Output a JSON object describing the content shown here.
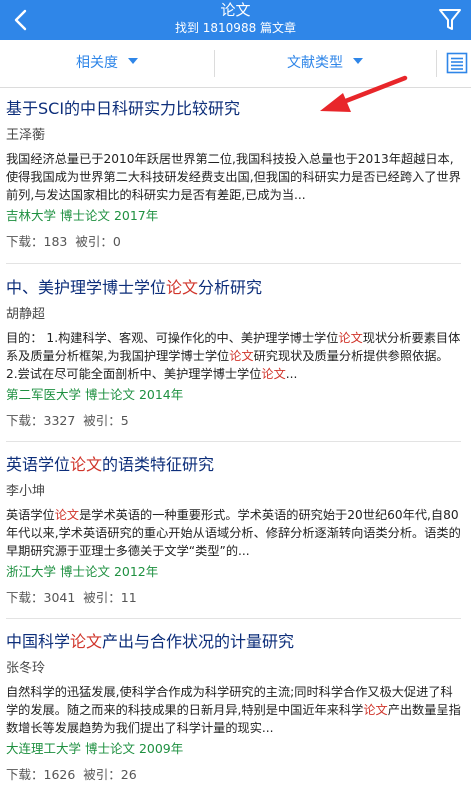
{
  "header": {
    "title": "论文",
    "subtitle": "找到 1810988 篇文章",
    "back_icon": "chevron-left-icon",
    "filter_icon": "filter-funnel-icon"
  },
  "sortbar": {
    "relevance_label": "相关度",
    "type_label": "文献类型",
    "view_icon": "list-view-icon"
  },
  "results": [
    {
      "title": [
        "基于SCI的中日科研实力比较研究"
      ],
      "author": "王泽蘅",
      "abstract": [
        "我国经济总量已于2010年跃居世界第二位,我国科技投入总量也于2013年超越日本,使得我国成为世界第二大科技研发经费支出国,但我国的科研实力是否已经跨入了世界前列,与发达国家相比的科研实力是否有差距,已成为当..."
      ],
      "source": "吉林大学 博士论文 2017年",
      "downloads": "下载：183",
      "citations": "被引：0"
    },
    {
      "title": [
        "中、美护理学博士学位",
        "论文",
        "分析研究"
      ],
      "author": "胡静超",
      "abstract": [
        "目的：  1.构建科学、客观、可操作化的中、美护理学博士学位",
        "论文",
        "现状分析要素目体系及质量分析框架,为我国护理学博士学位",
        "论文",
        "研究现状及质量分析提供参照依据。  2.尝试在尽可能全面剖析中、美护理学博士学位",
        "论文",
        "..."
      ],
      "source": "第二军医大学 博士论文 2014年",
      "downloads": "下载：3327",
      "citations": "被引：5"
    },
    {
      "title": [
        "英语学位",
        "论文",
        "的语类特征研究"
      ],
      "author": "李小坤",
      "abstract": [
        "英语学位",
        "论文",
        "是学术英语的一种重要形式。学术英语的研究始于20世纪60年代,自80年代以来,学术英语研究的重心开始从语域分析、修辞分析逐渐转向语类分析。语类的早期研究源于亚理士多德关于文学“类型”的..."
      ],
      "source": "浙江大学 博士论文 2012年",
      "downloads": "下载：3041",
      "citations": "被引：11"
    },
    {
      "title": [
        "中国科学",
        "论文",
        "产出与合作状况的计量研究"
      ],
      "author": "张冬玲",
      "abstract": [
        "  自然科学的迅猛发展,使科学合作成为科学研究的主流;同时科学合作又极大促进了科学的发展。随之而来的科技成果的日新月异,特别是中国近年来科学",
        "论文",
        "产出数量呈指数增长等发展趋势为我们提出了科学计量的现实..."
      ],
      "source": "大连理工大学 博士论文 2009年",
      "downloads": "下载：1626",
      "citations": "被引：26"
    }
  ],
  "colors": {
    "header_bg": "#2f86e8",
    "accent": "#2f86e8",
    "title_text": "#0d2e7a",
    "highlight": "#d0352b",
    "source_text": "#1e9040",
    "annotation_arrow": "#e8262a"
  }
}
